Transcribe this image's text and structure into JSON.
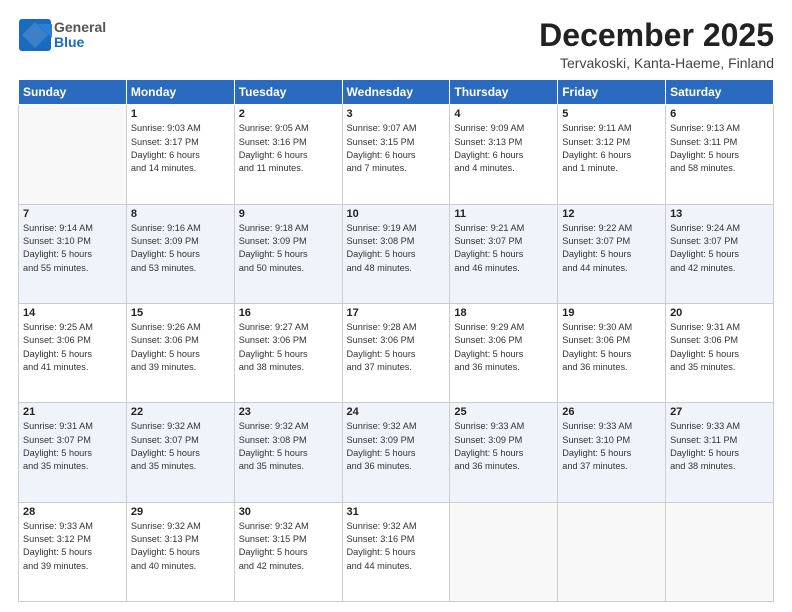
{
  "logo": {
    "general": "General",
    "blue": "Blue"
  },
  "header": {
    "month": "December 2025",
    "location": "Tervakoski, Kanta-Haeme, Finland"
  },
  "weekdays": [
    "Sunday",
    "Monday",
    "Tuesday",
    "Wednesday",
    "Thursday",
    "Friday",
    "Saturday"
  ],
  "weeks": [
    [
      {
        "day": "",
        "info": ""
      },
      {
        "day": "1",
        "info": "Sunrise: 9:03 AM\nSunset: 3:17 PM\nDaylight: 6 hours\nand 14 minutes."
      },
      {
        "day": "2",
        "info": "Sunrise: 9:05 AM\nSunset: 3:16 PM\nDaylight: 6 hours\nand 11 minutes."
      },
      {
        "day": "3",
        "info": "Sunrise: 9:07 AM\nSunset: 3:15 PM\nDaylight: 6 hours\nand 7 minutes."
      },
      {
        "day": "4",
        "info": "Sunrise: 9:09 AM\nSunset: 3:13 PM\nDaylight: 6 hours\nand 4 minutes."
      },
      {
        "day": "5",
        "info": "Sunrise: 9:11 AM\nSunset: 3:12 PM\nDaylight: 6 hours\nand 1 minute."
      },
      {
        "day": "6",
        "info": "Sunrise: 9:13 AM\nSunset: 3:11 PM\nDaylight: 5 hours\nand 58 minutes."
      }
    ],
    [
      {
        "day": "7",
        "info": "Sunrise: 9:14 AM\nSunset: 3:10 PM\nDaylight: 5 hours\nand 55 minutes."
      },
      {
        "day": "8",
        "info": "Sunrise: 9:16 AM\nSunset: 3:09 PM\nDaylight: 5 hours\nand 53 minutes."
      },
      {
        "day": "9",
        "info": "Sunrise: 9:18 AM\nSunset: 3:09 PM\nDaylight: 5 hours\nand 50 minutes."
      },
      {
        "day": "10",
        "info": "Sunrise: 9:19 AM\nSunset: 3:08 PM\nDaylight: 5 hours\nand 48 minutes."
      },
      {
        "day": "11",
        "info": "Sunrise: 9:21 AM\nSunset: 3:07 PM\nDaylight: 5 hours\nand 46 minutes."
      },
      {
        "day": "12",
        "info": "Sunrise: 9:22 AM\nSunset: 3:07 PM\nDaylight: 5 hours\nand 44 minutes."
      },
      {
        "day": "13",
        "info": "Sunrise: 9:24 AM\nSunset: 3:07 PM\nDaylight: 5 hours\nand 42 minutes."
      }
    ],
    [
      {
        "day": "14",
        "info": "Sunrise: 9:25 AM\nSunset: 3:06 PM\nDaylight: 5 hours\nand 41 minutes."
      },
      {
        "day": "15",
        "info": "Sunrise: 9:26 AM\nSunset: 3:06 PM\nDaylight: 5 hours\nand 39 minutes."
      },
      {
        "day": "16",
        "info": "Sunrise: 9:27 AM\nSunset: 3:06 PM\nDaylight: 5 hours\nand 38 minutes."
      },
      {
        "day": "17",
        "info": "Sunrise: 9:28 AM\nSunset: 3:06 PM\nDaylight: 5 hours\nand 37 minutes."
      },
      {
        "day": "18",
        "info": "Sunrise: 9:29 AM\nSunset: 3:06 PM\nDaylight: 5 hours\nand 36 minutes."
      },
      {
        "day": "19",
        "info": "Sunrise: 9:30 AM\nSunset: 3:06 PM\nDaylight: 5 hours\nand 36 minutes."
      },
      {
        "day": "20",
        "info": "Sunrise: 9:31 AM\nSunset: 3:06 PM\nDaylight: 5 hours\nand 35 minutes."
      }
    ],
    [
      {
        "day": "21",
        "info": "Sunrise: 9:31 AM\nSunset: 3:07 PM\nDaylight: 5 hours\nand 35 minutes."
      },
      {
        "day": "22",
        "info": "Sunrise: 9:32 AM\nSunset: 3:07 PM\nDaylight: 5 hours\nand 35 minutes."
      },
      {
        "day": "23",
        "info": "Sunrise: 9:32 AM\nSunset: 3:08 PM\nDaylight: 5 hours\nand 35 minutes."
      },
      {
        "day": "24",
        "info": "Sunrise: 9:32 AM\nSunset: 3:09 PM\nDaylight: 5 hours\nand 36 minutes."
      },
      {
        "day": "25",
        "info": "Sunrise: 9:33 AM\nSunset: 3:09 PM\nDaylight: 5 hours\nand 36 minutes."
      },
      {
        "day": "26",
        "info": "Sunrise: 9:33 AM\nSunset: 3:10 PM\nDaylight: 5 hours\nand 37 minutes."
      },
      {
        "day": "27",
        "info": "Sunrise: 9:33 AM\nSunset: 3:11 PM\nDaylight: 5 hours\nand 38 minutes."
      }
    ],
    [
      {
        "day": "28",
        "info": "Sunrise: 9:33 AM\nSunset: 3:12 PM\nDaylight: 5 hours\nand 39 minutes."
      },
      {
        "day": "29",
        "info": "Sunrise: 9:32 AM\nSunset: 3:13 PM\nDaylight: 5 hours\nand 40 minutes."
      },
      {
        "day": "30",
        "info": "Sunrise: 9:32 AM\nSunset: 3:15 PM\nDaylight: 5 hours\nand 42 minutes."
      },
      {
        "day": "31",
        "info": "Sunrise: 9:32 AM\nSunset: 3:16 PM\nDaylight: 5 hours\nand 44 minutes."
      },
      {
        "day": "",
        "info": ""
      },
      {
        "day": "",
        "info": ""
      },
      {
        "day": "",
        "info": ""
      }
    ]
  ]
}
